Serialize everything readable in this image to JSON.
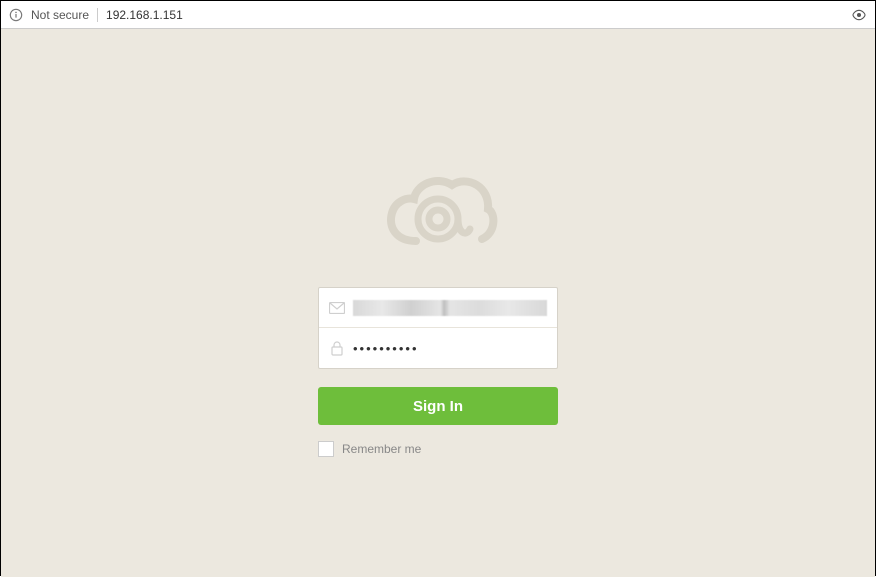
{
  "browser": {
    "security_label": "Not secure",
    "url": "192.168.1.151"
  },
  "login": {
    "email_value": "",
    "password_value": "••••••••••",
    "signin_label": "Sign In",
    "remember_label": "Remember me"
  }
}
